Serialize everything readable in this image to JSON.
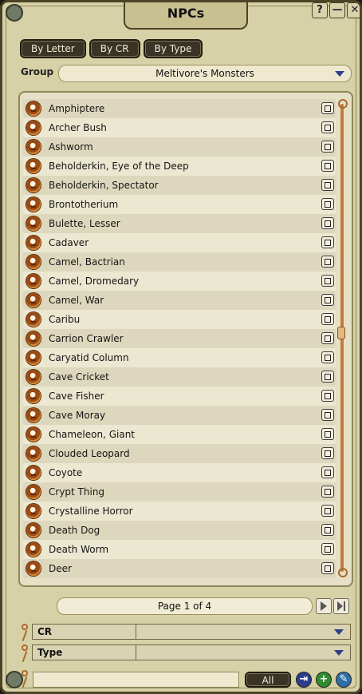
{
  "window": {
    "title": "NPCs",
    "help_label": "?",
    "minimize_label": "—",
    "close_label": "✕"
  },
  "tabs": [
    {
      "label": "By Letter"
    },
    {
      "label": "By CR"
    },
    {
      "label": "By Type"
    }
  ],
  "group": {
    "label": "Group",
    "value": "Meltivore's Monsters"
  },
  "npcs": [
    "Amphiptere",
    "Archer Bush",
    "Ashworm",
    "Beholderkin, Eye of the Deep",
    "Beholderkin, Spectator",
    "Brontotherium",
    "Bulette, Lesser",
    "Cadaver",
    "Camel, Bactrian",
    "Camel, Dromedary",
    "Camel, War",
    "Caribu",
    "Carrion Crawler",
    "Caryatid Column",
    "Cave Cricket",
    "Cave Fisher",
    "Cave Moray",
    "Chameleon, Giant",
    "Clouded Leopard",
    "Coyote",
    "Crypt Thing",
    "Crystalline Horror",
    "Death Dog",
    "Death Worm",
    "Deer"
  ],
  "pager": {
    "text": "Page 1 of 4"
  },
  "filters": [
    {
      "label": "CR",
      "value": ""
    },
    {
      "label": "Type",
      "value": ""
    }
  ],
  "search": {
    "value": "",
    "all_label": "All"
  },
  "colors": {
    "accent_blue": "#2c3e8c",
    "add_green": "#2e8b2e",
    "edit_blue": "#2f6fa8",
    "token_orange": "#c0641d"
  }
}
